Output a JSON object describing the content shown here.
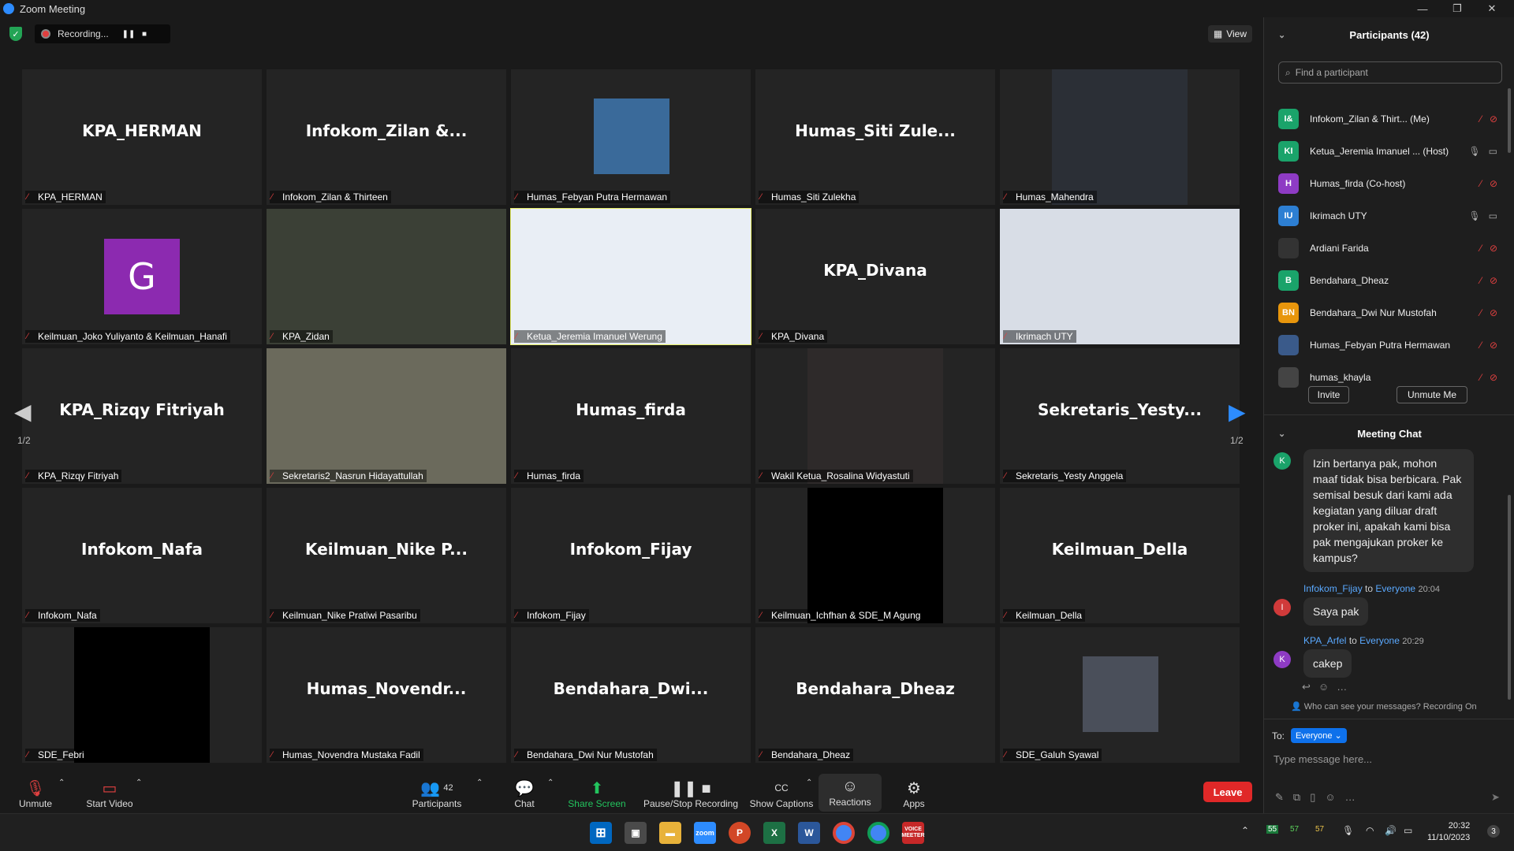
{
  "window": {
    "title": "Zoom Meeting"
  },
  "topbar": {
    "recording_label": "Recording...",
    "view_label": "View"
  },
  "tiles": [
    {
      "big": "KPA_HERMAN",
      "label": "KPA_HERMAN"
    },
    {
      "big": "Infokom_Zilan  &...",
      "label": "Infokom_Zilan & Thirteen"
    },
    {
      "big": "",
      "label": "Humas_Febyan Putra Hermawan"
    },
    {
      "big": "Humas_Siti  Zule...",
      "label": "Humas_Siti Zulekha"
    },
    {
      "big": "",
      "label": "Humas_Mahendra"
    },
    {
      "big": "",
      "label": "Keilmuan_Joko Yuliyanto & Keilmuan_Hanafi",
      "avatar": "G"
    },
    {
      "big": "",
      "label": "KPA_Zidan"
    },
    {
      "big": "",
      "label": "Ketua_Jeremia Imanuel Werung"
    },
    {
      "big": "KPA_Divana",
      "label": "KPA_Divana"
    },
    {
      "big": "",
      "label": "Ikrimach UTY"
    },
    {
      "big": "KPA_Rizqy Fitriyah",
      "label": "KPA_Rizqy Fitriyah"
    },
    {
      "big": "",
      "label": "Sekretaris2_Nasrun Hidayattullah"
    },
    {
      "big": "Humas_firda",
      "label": "Humas_firda"
    },
    {
      "big": "",
      "label": "Wakil Ketua_Rosalina Widyastuti"
    },
    {
      "big": "Sekretaris_Yesty...",
      "label": "Sekretaris_Yesty Anggela"
    },
    {
      "big": "Infokom_Nafa",
      "label": "Infokom_Nafa"
    },
    {
      "big": "Keilmuan_Nike  P...",
      "label": "Keilmuan_Nike Pratiwi Pasaribu"
    },
    {
      "big": "Infokom_Fijay",
      "label": "Infokom_Fijay"
    },
    {
      "big": "",
      "label": "Keilmuan_Ichfhan & SDE_M Agung"
    },
    {
      "big": "Keilmuan_Della",
      "label": "Keilmuan_Della"
    },
    {
      "big": "",
      "label": "SDE_Febri"
    },
    {
      "big": "Humas_Novendr...",
      "label": "Humas_Novendra Mustaka Fadil"
    },
    {
      "big": "Bendahara_Dwi...",
      "label": "Bendahara_Dwi Nur Mustofah"
    },
    {
      "big": "Bendahara_Dheaz",
      "label": "Bendahara_Dheaz"
    },
    {
      "big": "",
      "label": "SDE_Galuh Syawal"
    }
  ],
  "page": {
    "left": "1/2",
    "right": "1/2"
  },
  "toolbar": {
    "unmute": "Unmute",
    "start_video": "Start Video",
    "participants": "Participants",
    "participants_count": "42",
    "chat": "Chat",
    "share_screen": "Share Screen",
    "pause_recording": "Pause/Stop Recording",
    "captions": "Show Captions",
    "reactions": "Reactions",
    "apps": "Apps",
    "leave": "Leave"
  },
  "participants_panel": {
    "title": "Participants (42)",
    "search_placeholder": "Find a participant",
    "items": [
      {
        "initials": "I&",
        "name": "Infokom_Zilan & Thirt...  (Me)",
        "color": "#1aa36a"
      },
      {
        "initials": "KI",
        "name": "Ketua_Jeremia Imanuel ...  (Host)",
        "color": "#1aa36a"
      },
      {
        "initials": "H",
        "name": "Humas_firda (Co-host)",
        "color": "#8e3bc4"
      },
      {
        "initials": "IU",
        "name": "Ikrimach UTY",
        "color": "#2d7fd3"
      },
      {
        "initials": "",
        "name": "Ardiani Farida",
        "color": "#333333"
      },
      {
        "initials": "B",
        "name": "Bendahara_Dheaz",
        "color": "#1aa36a"
      },
      {
        "initials": "BN",
        "name": "Bendahara_Dwi Nur Mustofah",
        "color": "#e8960c"
      },
      {
        "initials": "",
        "name": "Humas_Febyan Putra Hermawan",
        "color": "#3a5a8a"
      },
      {
        "initials": "",
        "name": "humas_khayla",
        "color": "#444444"
      }
    ],
    "invite": "Invite",
    "unmute_me": "Unmute Me"
  },
  "chat": {
    "title": "Meeting Chat",
    "messages": [
      {
        "avatar": "K",
        "text": "Izin bertanya pak, mohon maaf tidak bisa berbicara. Pak semisal besuk dari kami ada kegiatan yang diluar draft proker ini, apakah kami bisa pak mengajukan proker ke kampus?"
      },
      {
        "avatar": "I",
        "sender": "Infokom_Fijay",
        "to": "to",
        "recipient": "Everyone",
        "time": "20:04",
        "text": "Saya pak"
      },
      {
        "avatar": "K",
        "sender": "KPA_Arfel",
        "to": "to",
        "recipient": "Everyone",
        "time": "20:29",
        "text": "cakep"
      }
    ],
    "who_can_see": "Who can see your messages? Recording On",
    "to_label": "To:",
    "to_value": "Everyone",
    "placeholder": "Type message here..."
  },
  "taskbar": {
    "tray_a": "55",
    "tray_b": "57",
    "tray_c": "57",
    "time": "20:32",
    "date": "11/10/2023",
    "notif": "3",
    "voice_app": "VOICE MEETER"
  }
}
